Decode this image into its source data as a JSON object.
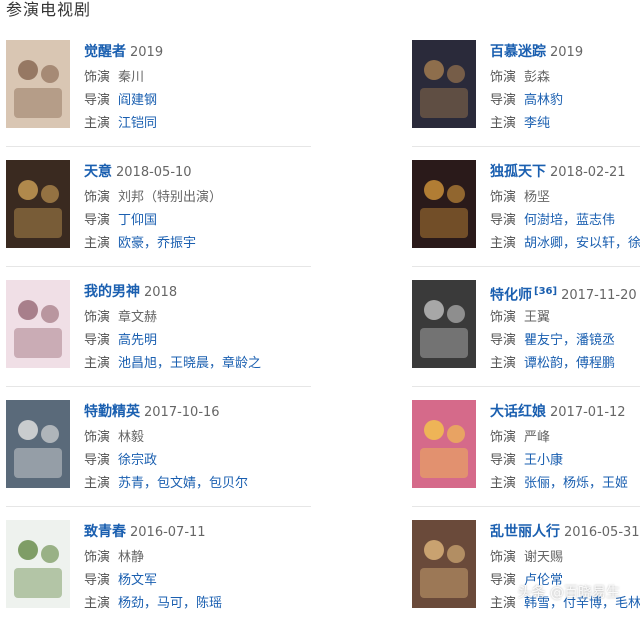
{
  "section_title": "参演电视剧",
  "labels": {
    "role": "饰演",
    "director": "导演",
    "cast": "主演"
  },
  "items": [
    {
      "title": "觉醒者",
      "date": "2019",
      "role": "秦川",
      "director": "阎建钢",
      "cast": "江铠同",
      "poster": {
        "bg": "#d9c6b3",
        "accent": "#8a6a55"
      }
    },
    {
      "title": "百慕迷踪",
      "date": "2019",
      "role": "彭森",
      "director": "高林豹",
      "cast": "李纯",
      "poster": {
        "bg": "#2a2a3a",
        "accent": "#a07a50"
      }
    },
    {
      "title": "天意",
      "date": "2018-05-10",
      "role": "刘邦（特别出演）",
      "director": "丁仰国",
      "cast": "欧豪，乔振宇",
      "poster": {
        "bg": "#3a2a20",
        "accent": "#c59a55"
      }
    },
    {
      "title": "独孤天下",
      "date": "2018-02-21",
      "role": "杨坚",
      "director": "何澍培，蓝志伟",
      "cast": "胡冰卿，安以轩，徐正溪",
      "poster": {
        "bg": "#2a1a1a",
        "accent": "#c98f3a"
      }
    },
    {
      "title": "我的男神",
      "date": "2018",
      "role": "章文赫",
      "director": "高先明",
      "cast": "池昌旭，王晓晨，章龄之",
      "poster": {
        "bg": "#f0dfe6",
        "accent": "#9b6f7a"
      }
    },
    {
      "title": "特化师",
      "date": "2017-11-20",
      "sup": "[36]",
      "role": "王翼",
      "director": "瞿友宁，潘镜丞",
      "cast": "谭松韵，傅程鹏",
      "poster": {
        "bg": "#3a3a3a",
        "accent": "#bbbbbb"
      }
    },
    {
      "title": "特勤精英",
      "date": "2017-10-16",
      "role": "林毅",
      "director": "徐宗政",
      "cast": "苏青，包文婧，包贝尔",
      "poster": {
        "bg": "#5a6a7a",
        "accent": "#dddddd"
      }
    },
    {
      "title": "大话红娘",
      "date": "2017-01-12",
      "role": "严峰",
      "director": "王小康",
      "cast": "张俪，杨烁，王姬",
      "poster": {
        "bg": "#d56a8a",
        "accent": "#f2c14e"
      }
    },
    {
      "title": "致青春",
      "date": "2016-07-11",
      "role": "林静",
      "director": "杨文军",
      "cast": "杨劲，马可，陈瑶",
      "poster": {
        "bg": "#eef2ee",
        "accent": "#6b8e4e"
      }
    },
    {
      "title": "乱世丽人行",
      "date": "2016-05-31",
      "role": "谢天赐",
      "director": "卢伦常",
      "cast": "韩雪，付辛博，毛林林",
      "poster": {
        "bg": "#6a4a3a",
        "accent": "#d9b27a"
      }
    }
  ],
  "watermark": "头条 @百晓易生"
}
